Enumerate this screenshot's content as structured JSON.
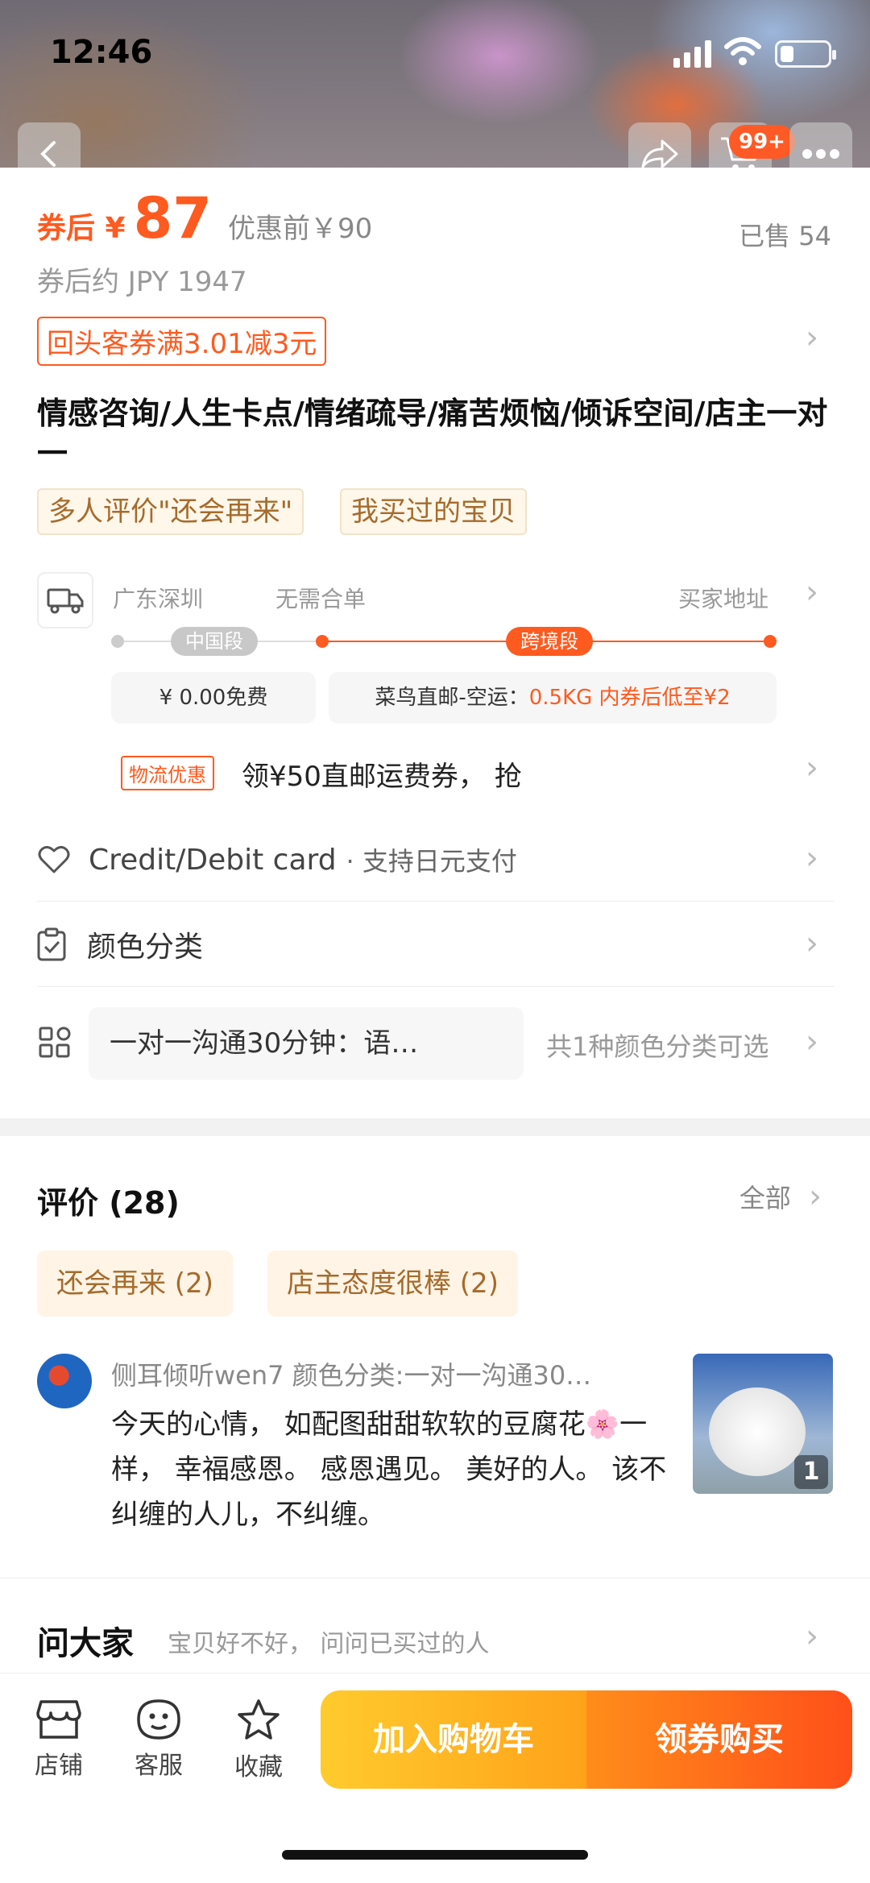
{
  "status_bar": {
    "time": "12:46"
  },
  "header": {
    "cart_badge": "99+"
  },
  "price": {
    "after_coupon_label": "券后 ¥",
    "after_coupon_value": "87",
    "before_label": "优惠前￥90",
    "sold": "已售 54",
    "jpy_approx": "券后约 JPY 1947",
    "coupon_text": "回头客券满3.01减3元"
  },
  "product": {
    "title": "情感咨询/人生卡点/情绪疏导/痛苦烦恼/倾诉空间/店主一对一",
    "tags": [
      "多人评价\"还会再来\"",
      "我买过的宝贝"
    ]
  },
  "shipping": {
    "from": "广东深圳",
    "merge": "无需合单",
    "to": "买家地址",
    "segment_cn": "中国段",
    "segment_cross": "跨境段",
    "fee_cn": "¥ 0.00免费",
    "fee_cross_prefix": "菜鸟直邮-空运：",
    "fee_cross_highlight": "0.5KG 内券后低至¥2",
    "logistics_tag": "物流优惠",
    "logistics_text": "领¥50直邮运费券， 抢"
  },
  "payment": {
    "label": "Credit/Debit card",
    "sub": "· 支持日元支付"
  },
  "color": {
    "label": "颜色分类",
    "selected": "一对一沟通30分钟：语…",
    "count_text": "共1种颜色分类可选"
  },
  "reviews": {
    "title": "评价 (28)",
    "all": "全部",
    "tags": [
      "还会再来 (2)",
      "店主态度很棒 (2)"
    ],
    "item": {
      "user_line": "侧耳倾听wen7  颜色分类:一对一沟通30…",
      "text": "今天的心情， 如配图甜甜软软的豆腐花🌸一样， 幸福感恩。 感恩遇见。 美好的人。 该不纠缠的人儿，不纠缠。",
      "photo_count": "1"
    }
  },
  "ask": {
    "title": "问大家",
    "sub": "宝贝好不好， 问问已买过的人"
  },
  "bottom_bar": {
    "shop": "店铺",
    "service": "客服",
    "favorite": "收藏",
    "add_cart": "加入购物车",
    "buy": "领券购买"
  },
  "colors": {
    "accent": "#ff5a1f",
    "tag_text": "#a56b2c"
  },
  "icons": [
    "back-icon",
    "share-icon",
    "cart-icon",
    "more-icon",
    "truck-icon",
    "chevron-right-icon",
    "card-icon",
    "clipboard-icon",
    "grid-icon",
    "shop-icon",
    "service-icon",
    "star-icon"
  ]
}
